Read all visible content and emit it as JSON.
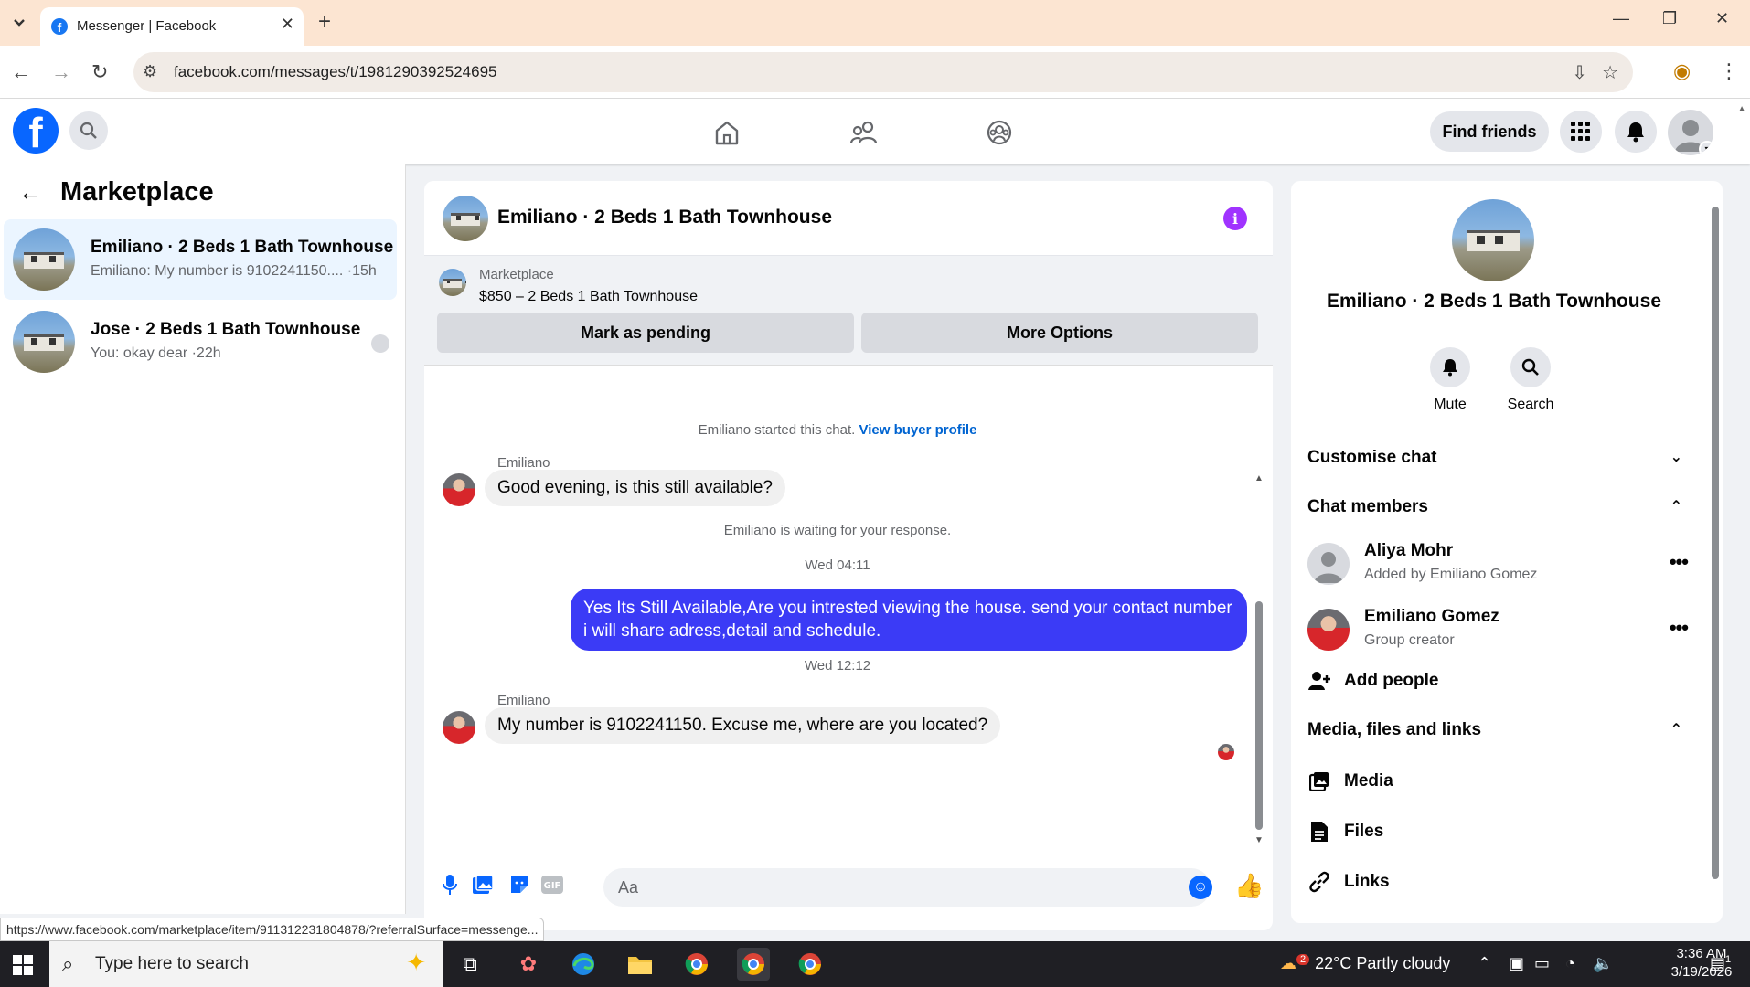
{
  "browser": {
    "tab_title": "Messenger | Facebook",
    "url": "facebook.com/messages/t/1981290392524695",
    "status_url": "https://www.facebook.com/marketplace/item/911312231804878/?referralSurface=messenge..."
  },
  "header": {
    "find_friends": "Find friends"
  },
  "sidebar": {
    "title": "Marketplace",
    "conversations": [
      {
        "name": "Emiliano · 2 Beds 1 Bath Townhouse",
        "preview": "Emiliano: My number is 9102241150.... ·15h"
      },
      {
        "name": "Jose · 2 Beds 1 Bath Townhouse",
        "preview": "You: okay dear ·22h"
      }
    ]
  },
  "chat": {
    "title": "Emiliano · 2 Beds 1 Bath Townhouse",
    "marketplace_label": "Marketplace",
    "listing": "$850 – 2 Beds 1 Bath Townhouse",
    "mark_pending": "Mark as pending",
    "more_options": "More Options",
    "started_text": "Emiliano started this chat.",
    "view_profile": "View buyer profile",
    "sender1": "Emiliano",
    "msg1": "Good evening, is this still available?",
    "waiting": "Emiliano is waiting for your response.",
    "time1": "Wed 04:11",
    "msg2": "Yes Its Still Available,Are you intrested viewing the house. send your contact number i will share adress,detail and schedule.",
    "time2": "Wed 12:12",
    "sender2": "Emiliano",
    "msg3": "My number is 9102241150. Excuse me, where are you located?",
    "input_placeholder": "Aa"
  },
  "details": {
    "name": "Emiliano · 2 Beds 1 Bath Townhouse",
    "mute": "Mute",
    "search": "Search",
    "customise": "Customise chat",
    "members_title": "Chat members",
    "members": [
      {
        "name": "Aliya Mohr",
        "sub": "Added by Emiliano Gomez"
      },
      {
        "name": "Emiliano Gomez",
        "sub": "Group creator"
      }
    ],
    "add_people": "Add people",
    "media_title": "Media, files and links",
    "media": "Media",
    "files": "Files",
    "links": "Links"
  },
  "taskbar": {
    "search_placeholder": "Type here to search",
    "weather": "22°C  Partly cloudy",
    "time": "3:36 AM",
    "date": "3/19/2026",
    "notification_count": "1",
    "weather_badge": "2"
  }
}
